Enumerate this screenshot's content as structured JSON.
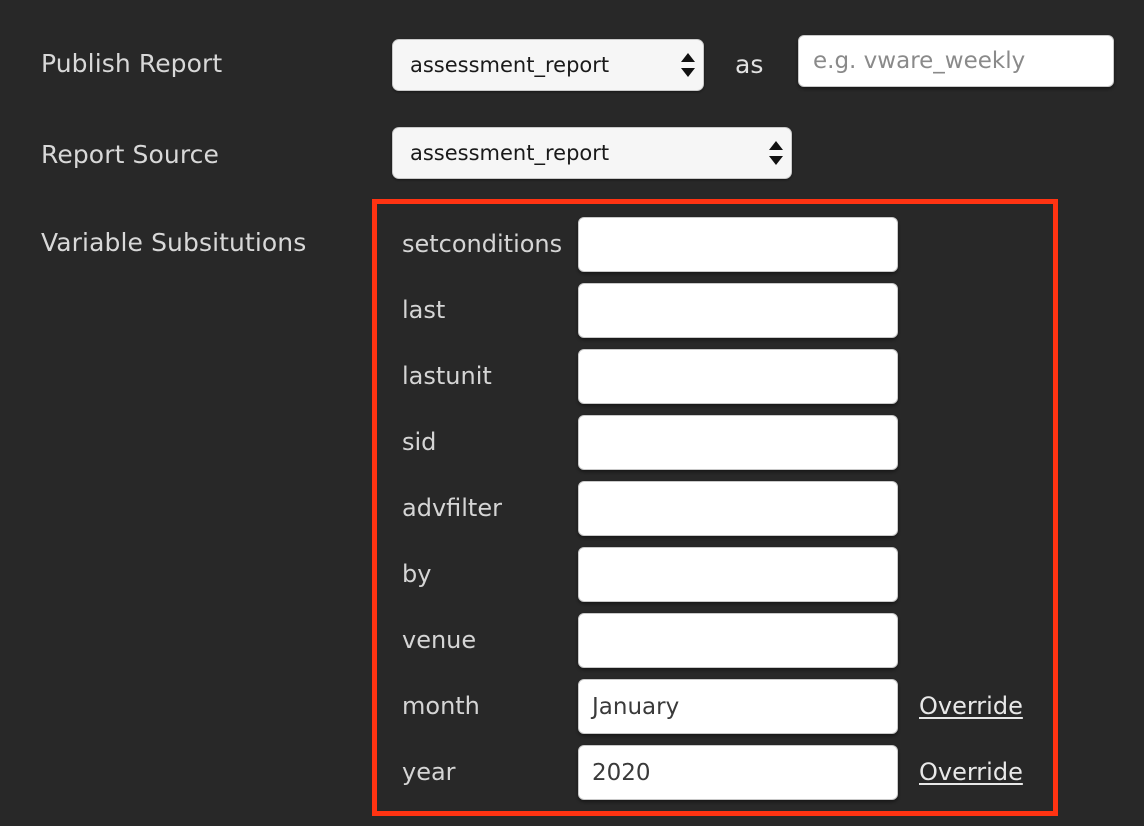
{
  "theme": {
    "background": "#282828",
    "label_color": "#d8d8d8",
    "highlight_border": "#ff3312",
    "input_background": "#ffffff",
    "select_background": "#f6f6f6"
  },
  "form": {
    "publish_report": {
      "label": "Publish Report",
      "select_value": "assessment_report",
      "select_options": [
        "assessment_report"
      ],
      "as_label": "as",
      "name_input_value": "",
      "name_input_placeholder": "e.g. vware_weekly"
    },
    "report_source": {
      "label": "Report Source",
      "select_value": "assessment_report",
      "select_options": [
        "assessment_report"
      ]
    },
    "variable_substitutions": {
      "label": "Variable Subsitutions",
      "override_label": "Override",
      "rows": [
        {
          "name": "setconditions",
          "value": "",
          "has_override": false
        },
        {
          "name": "last",
          "value": "",
          "has_override": false
        },
        {
          "name": "lastunit",
          "value": "",
          "has_override": false
        },
        {
          "name": "sid",
          "value": "",
          "has_override": false
        },
        {
          "name": "advfilter",
          "value": "",
          "has_override": false
        },
        {
          "name": "by",
          "value": "",
          "has_override": false
        },
        {
          "name": "venue",
          "value": "",
          "has_override": false
        },
        {
          "name": "month",
          "value": "January",
          "has_override": true
        },
        {
          "name": "year",
          "value": "2020",
          "has_override": true
        }
      ]
    }
  },
  "icons": {
    "stepper": "up-down-triangle-icon"
  }
}
